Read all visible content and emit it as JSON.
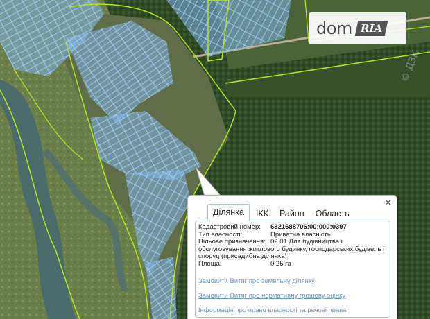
{
  "logo": {
    "brand": "dom",
    "badge": "RIA"
  },
  "watermark": "© ДЗК",
  "popup": {
    "close_label": "×",
    "tabs": [
      {
        "label": "Ділянка",
        "active": true
      },
      {
        "label": "ІКК",
        "active": false
      },
      {
        "label": "Район",
        "active": false
      },
      {
        "label": "Область",
        "active": false
      }
    ],
    "fields": {
      "cadastral_label": "Кадастровий номер:",
      "cadastral_value": "6321688706:00:000:0397",
      "ownership_label": "Тип власності:",
      "ownership_value": "Приватна власність",
      "purpose_label": "Цільове призначення:",
      "purpose_value": "02.01 Для будівництва і обслуговування житлового будинку, господарських будівель і споруд (присадибна ділянка)",
      "area_label": "Площа:",
      "area_value": "0.25 га"
    },
    "links": [
      "Замовити Витяг про земельну ділянку",
      "Замовити Витяг про нормативну грошову оцінку",
      "Інформація про право власності та речові права"
    ]
  },
  "colors": {
    "parcel_fill": "#7fb3e6",
    "parcel_stroke": "#9fd0ff",
    "boundary": "#b5e61d",
    "river": "#4b6b6e",
    "link": "#6d9ac4"
  }
}
